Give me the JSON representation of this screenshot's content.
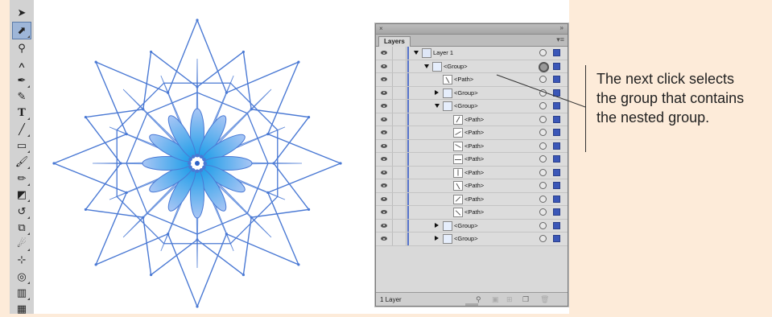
{
  "panel": {
    "tab_label": "Layers",
    "footer_count": "1 Layer",
    "rows": [
      {
        "label": "Layer 1",
        "indent": 0,
        "arrow": "down",
        "selected_target": false
      },
      {
        "label": "<Group>",
        "indent": 1,
        "arrow": "down",
        "selected_target": true
      },
      {
        "label": "<Path>",
        "indent": 2,
        "arrow": "none",
        "selected_target": false
      },
      {
        "label": "<Group>",
        "indent": 2,
        "arrow": "right",
        "selected_target": false
      },
      {
        "label": "<Group>",
        "indent": 2,
        "arrow": "down",
        "selected_target": false
      },
      {
        "label": "<Path>",
        "indent": 3,
        "arrow": "none",
        "selected_target": false
      },
      {
        "label": "<Path>",
        "indent": 3,
        "arrow": "none",
        "selected_target": false
      },
      {
        "label": "<Path>",
        "indent": 3,
        "arrow": "none",
        "selected_target": false
      },
      {
        "label": "<Path>",
        "indent": 3,
        "arrow": "none",
        "selected_target": false
      },
      {
        "label": "<Path>",
        "indent": 3,
        "arrow": "none",
        "selected_target": false
      },
      {
        "label": "<Path>",
        "indent": 3,
        "arrow": "none",
        "selected_target": false
      },
      {
        "label": "<Path>",
        "indent": 3,
        "arrow": "none",
        "selected_target": false
      },
      {
        "label": "<Path>",
        "indent": 3,
        "arrow": "none",
        "selected_target": false
      },
      {
        "label": "<Group>",
        "indent": 2,
        "arrow": "right",
        "selected_target": false
      },
      {
        "label": "<Group>",
        "indent": 2,
        "arrow": "right",
        "selected_target": false
      }
    ]
  },
  "callout": {
    "line1": "The next click selects",
    "line2": "the group that contains",
    "line3": "the nested group."
  },
  "colors": {
    "page_background": "#fdebd9",
    "art_stroke": "#4a79d4",
    "art_fill": "#8fb4ee",
    "selection_blue": "#3b57b8"
  },
  "tools": [
    "selection-arrow-icon",
    "direct-selection-plus-icon",
    "magic-wand-icon",
    "lasso-icon",
    "pen-icon",
    "pencil-curvature-icon",
    "type-icon",
    "line-segment-icon",
    "rectangle-icon",
    "paintbrush-icon",
    "blob-brush-icon",
    "eraser-icon",
    "rotate-icon",
    "scale-icon",
    "warp-icon",
    "free-transform-icon",
    "shape-builder-icon",
    "graph-icon",
    "mesh-icon"
  ]
}
